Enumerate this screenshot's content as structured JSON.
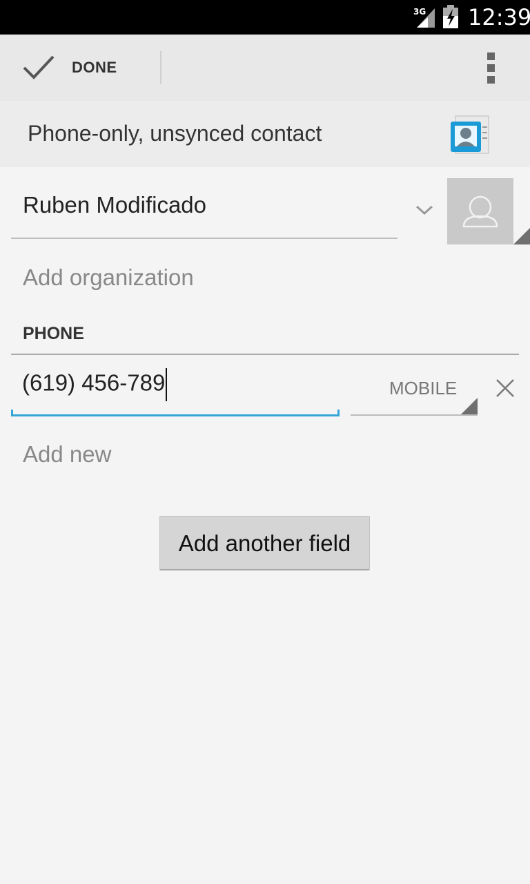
{
  "status_bar": {
    "network": "3G",
    "time": "12:39"
  },
  "action_bar": {
    "done_label": "DONE",
    "overflow_icon": "more-vert-icon"
  },
  "account": {
    "title": "Phone-only, unsynced contact",
    "icon": "contacts-app-icon"
  },
  "contact": {
    "name": "Ruben Modificado",
    "photo_icon": "person-placeholder-icon"
  },
  "organization": {
    "placeholder": "Add organization"
  },
  "phone_section": {
    "header": "PHONE",
    "number": "(619) 456-789",
    "type": "MOBILE",
    "add_new": "Add new"
  },
  "add_field_button": "Add another field",
  "colors": {
    "accent": "#33a5d6",
    "background": "#f4f4f4",
    "action_bar": "#e8e8e8"
  }
}
